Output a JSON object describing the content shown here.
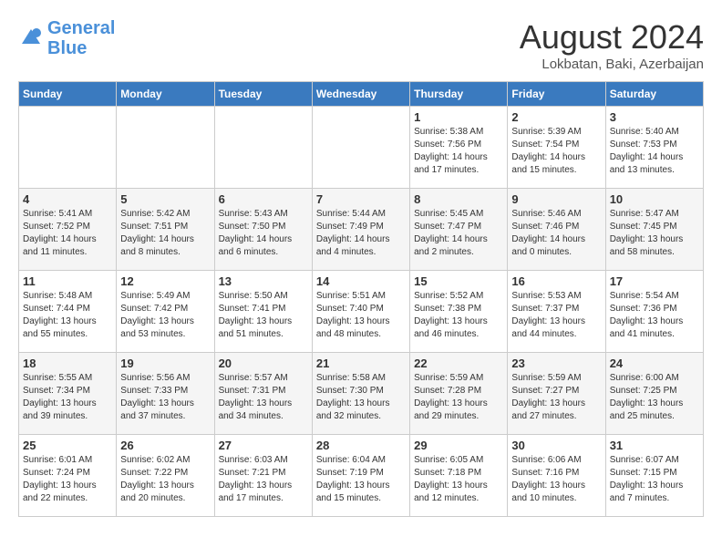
{
  "header": {
    "logo_line1": "General",
    "logo_line2": "Blue",
    "month_year": "August 2024",
    "location": "Lokbatan, Baki, Azerbaijan"
  },
  "weekdays": [
    "Sunday",
    "Monday",
    "Tuesday",
    "Wednesday",
    "Thursday",
    "Friday",
    "Saturday"
  ],
  "weeks": [
    [
      {
        "day": "",
        "info": ""
      },
      {
        "day": "",
        "info": ""
      },
      {
        "day": "",
        "info": ""
      },
      {
        "day": "",
        "info": ""
      },
      {
        "day": "1",
        "info": "Sunrise: 5:38 AM\nSunset: 7:56 PM\nDaylight: 14 hours\nand 17 minutes."
      },
      {
        "day": "2",
        "info": "Sunrise: 5:39 AM\nSunset: 7:54 PM\nDaylight: 14 hours\nand 15 minutes."
      },
      {
        "day": "3",
        "info": "Sunrise: 5:40 AM\nSunset: 7:53 PM\nDaylight: 14 hours\nand 13 minutes."
      }
    ],
    [
      {
        "day": "4",
        "info": "Sunrise: 5:41 AM\nSunset: 7:52 PM\nDaylight: 14 hours\nand 11 minutes."
      },
      {
        "day": "5",
        "info": "Sunrise: 5:42 AM\nSunset: 7:51 PM\nDaylight: 14 hours\nand 8 minutes."
      },
      {
        "day": "6",
        "info": "Sunrise: 5:43 AM\nSunset: 7:50 PM\nDaylight: 14 hours\nand 6 minutes."
      },
      {
        "day": "7",
        "info": "Sunrise: 5:44 AM\nSunset: 7:49 PM\nDaylight: 14 hours\nand 4 minutes."
      },
      {
        "day": "8",
        "info": "Sunrise: 5:45 AM\nSunset: 7:47 PM\nDaylight: 14 hours\nand 2 minutes."
      },
      {
        "day": "9",
        "info": "Sunrise: 5:46 AM\nSunset: 7:46 PM\nDaylight: 14 hours\nand 0 minutes."
      },
      {
        "day": "10",
        "info": "Sunrise: 5:47 AM\nSunset: 7:45 PM\nDaylight: 13 hours\nand 58 minutes."
      }
    ],
    [
      {
        "day": "11",
        "info": "Sunrise: 5:48 AM\nSunset: 7:44 PM\nDaylight: 13 hours\nand 55 minutes."
      },
      {
        "day": "12",
        "info": "Sunrise: 5:49 AM\nSunset: 7:42 PM\nDaylight: 13 hours\nand 53 minutes."
      },
      {
        "day": "13",
        "info": "Sunrise: 5:50 AM\nSunset: 7:41 PM\nDaylight: 13 hours\nand 51 minutes."
      },
      {
        "day": "14",
        "info": "Sunrise: 5:51 AM\nSunset: 7:40 PM\nDaylight: 13 hours\nand 48 minutes."
      },
      {
        "day": "15",
        "info": "Sunrise: 5:52 AM\nSunset: 7:38 PM\nDaylight: 13 hours\nand 46 minutes."
      },
      {
        "day": "16",
        "info": "Sunrise: 5:53 AM\nSunset: 7:37 PM\nDaylight: 13 hours\nand 44 minutes."
      },
      {
        "day": "17",
        "info": "Sunrise: 5:54 AM\nSunset: 7:36 PM\nDaylight: 13 hours\nand 41 minutes."
      }
    ],
    [
      {
        "day": "18",
        "info": "Sunrise: 5:55 AM\nSunset: 7:34 PM\nDaylight: 13 hours\nand 39 minutes."
      },
      {
        "day": "19",
        "info": "Sunrise: 5:56 AM\nSunset: 7:33 PM\nDaylight: 13 hours\nand 37 minutes."
      },
      {
        "day": "20",
        "info": "Sunrise: 5:57 AM\nSunset: 7:31 PM\nDaylight: 13 hours\nand 34 minutes."
      },
      {
        "day": "21",
        "info": "Sunrise: 5:58 AM\nSunset: 7:30 PM\nDaylight: 13 hours\nand 32 minutes."
      },
      {
        "day": "22",
        "info": "Sunrise: 5:59 AM\nSunset: 7:28 PM\nDaylight: 13 hours\nand 29 minutes."
      },
      {
        "day": "23",
        "info": "Sunrise: 5:59 AM\nSunset: 7:27 PM\nDaylight: 13 hours\nand 27 minutes."
      },
      {
        "day": "24",
        "info": "Sunrise: 6:00 AM\nSunset: 7:25 PM\nDaylight: 13 hours\nand 25 minutes."
      }
    ],
    [
      {
        "day": "25",
        "info": "Sunrise: 6:01 AM\nSunset: 7:24 PM\nDaylight: 13 hours\nand 22 minutes."
      },
      {
        "day": "26",
        "info": "Sunrise: 6:02 AM\nSunset: 7:22 PM\nDaylight: 13 hours\nand 20 minutes."
      },
      {
        "day": "27",
        "info": "Sunrise: 6:03 AM\nSunset: 7:21 PM\nDaylight: 13 hours\nand 17 minutes."
      },
      {
        "day": "28",
        "info": "Sunrise: 6:04 AM\nSunset: 7:19 PM\nDaylight: 13 hours\nand 15 minutes."
      },
      {
        "day": "29",
        "info": "Sunrise: 6:05 AM\nSunset: 7:18 PM\nDaylight: 13 hours\nand 12 minutes."
      },
      {
        "day": "30",
        "info": "Sunrise: 6:06 AM\nSunset: 7:16 PM\nDaylight: 13 hours\nand 10 minutes."
      },
      {
        "day": "31",
        "info": "Sunrise: 6:07 AM\nSunset: 7:15 PM\nDaylight: 13 hours\nand 7 minutes."
      }
    ]
  ]
}
